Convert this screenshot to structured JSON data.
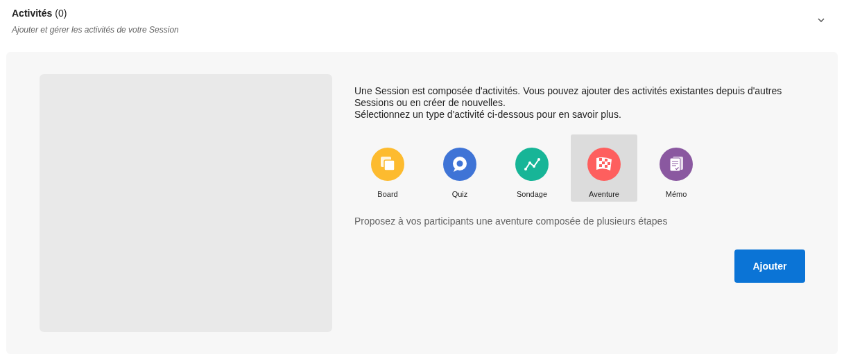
{
  "section": {
    "title": "**Activités** (0)",
    "subtitle": "Ajouter et gérer les activités de votre Session"
  },
  "intro": [
    "Une Session est composée d'activités. Vous pouvez ajouter des activités existantes depuis d'autres Sessions ou en créer de nouvelles.",
    "Sélectionnez un type d'activité ci-dessous pour en savoir plus."
  ],
  "activity_types": [
    {
      "kind": "board",
      "label": "Board",
      "color": "#fdbb2f",
      "selected": false
    },
    {
      "kind": "quiz",
      "label": "Quiz",
      "color": "#3f74d6",
      "selected": false
    },
    {
      "kind": "poll",
      "label": "Sondage",
      "color": "#17b597",
      "selected": false
    },
    {
      "kind": "adventure",
      "label": "Aventure",
      "color": "#fe5f5e",
      "selected": true
    },
    {
      "kind": "memo",
      "label": "Mémo",
      "color": "#8a58a0",
      "selected": false
    }
  ],
  "description": "Proposez à vos participants une aventure composée de plusieurs étapes",
  "add_button": "Ajouter"
}
